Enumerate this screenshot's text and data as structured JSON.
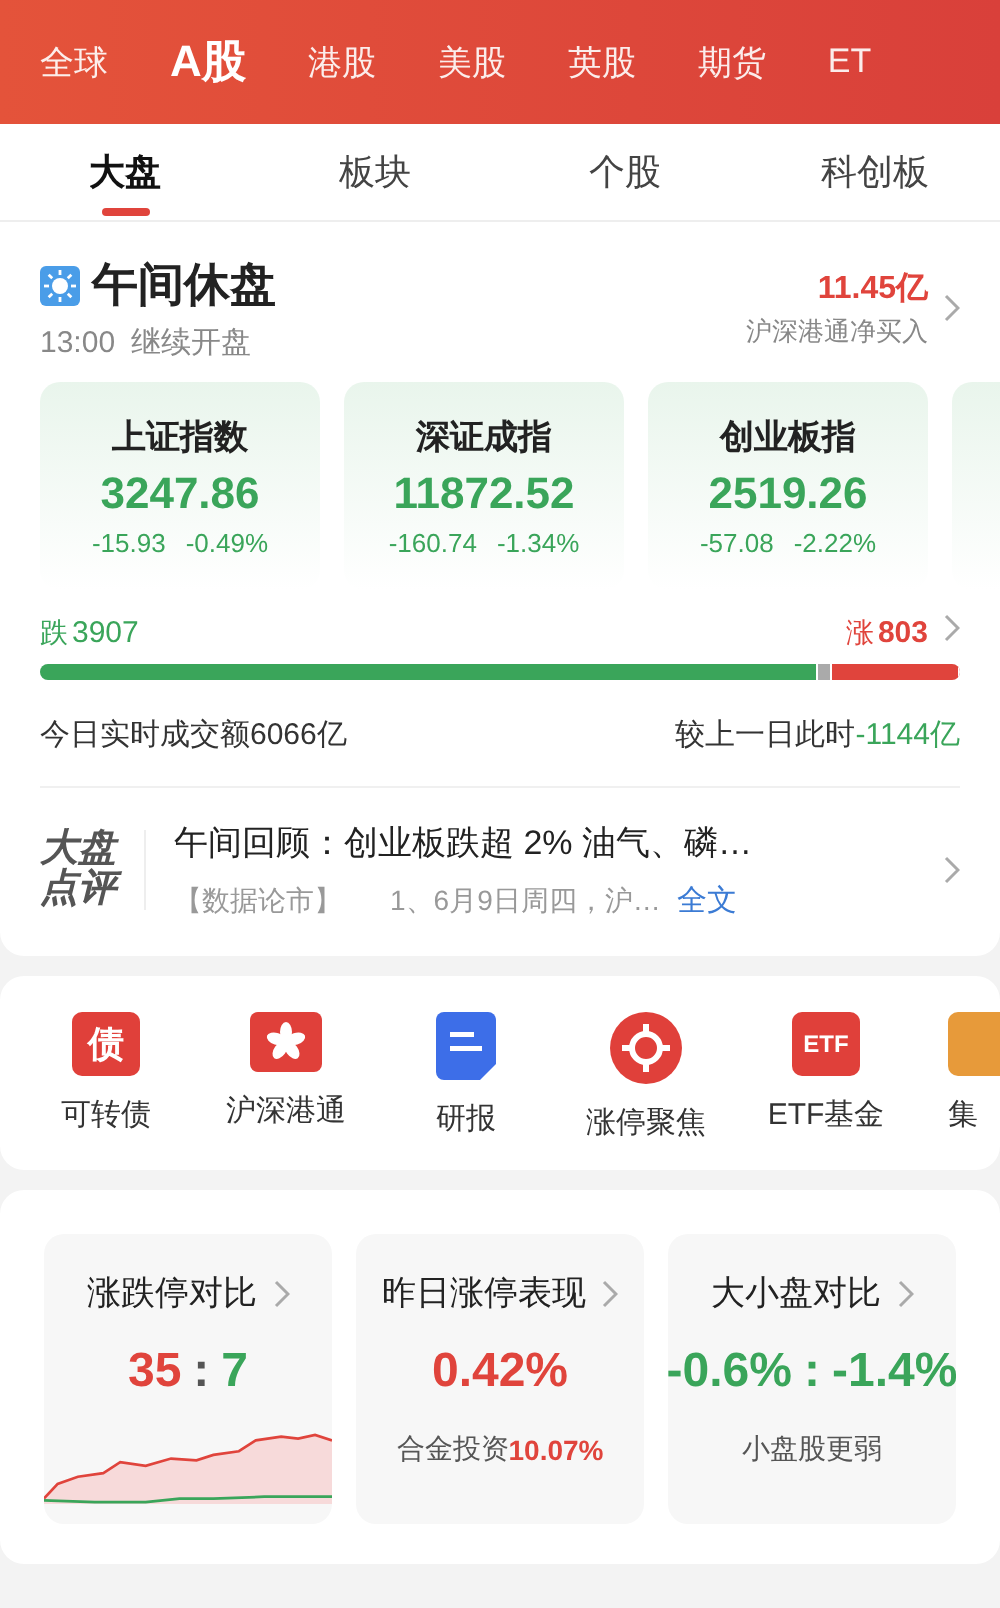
{
  "market_tabs": [
    {
      "label": "全球",
      "selected": false
    },
    {
      "label": "A股",
      "selected": true
    },
    {
      "label": "港股",
      "selected": false
    },
    {
      "label": "美股",
      "selected": false
    },
    {
      "label": "英股",
      "selected": false
    },
    {
      "label": "期货",
      "selected": false
    },
    {
      "label": "ET",
      "selected": false
    }
  ],
  "sub_tabs": [
    {
      "label": "大盘",
      "selected": true
    },
    {
      "label": "板块",
      "selected": false
    },
    {
      "label": "个股",
      "selected": false
    },
    {
      "label": "科创板",
      "selected": false
    }
  ],
  "session": {
    "title": "午间休盘",
    "time": "13:00",
    "note": "继续开盘",
    "flow_value": "11.45亿",
    "flow_label": "沪深港通净买入"
  },
  "indices": [
    {
      "kind": "index",
      "name": "上证指数",
      "price": "3247.86",
      "change": "-15.93",
      "percent": "-0.49%",
      "color": "#3aa55a"
    },
    {
      "kind": "index",
      "name": "深证成指",
      "price": "11872.52",
      "change": "-160.74",
      "percent": "-1.34%",
      "color": "#3aa55a"
    },
    {
      "kind": "index",
      "name": "创业板指",
      "price": "2519.26",
      "change": "-57.08",
      "percent": "-2.22%",
      "color": "#3aa55a"
    },
    {
      "kind": "cut"
    }
  ],
  "breadth": {
    "down_label": "跌",
    "down_count": "3907",
    "up_label": "涨",
    "up_count": "803",
    "segments": [
      {
        "kind": "down",
        "level": 0.845
      },
      {
        "kind": "flat"
      },
      {
        "kind": "up",
        "level": 0.14
      }
    ]
  },
  "turnover": {
    "label": "今日实时成交额",
    "value": "6066亿",
    "compare_label": "较上一日此时",
    "compare_value": "-1144亿"
  },
  "news": {
    "logo_top": "大盘",
    "logo_bottom": "点评",
    "title": "午间回顾：创业板跌超 2% 油气、磷…",
    "source": "【数据论市】",
    "snippet": "1、6月9日周四，沪…",
    "link": "全文"
  },
  "shortcuts": [
    {
      "kind": "glyph",
      "glyph": "债",
      "label": "可转债"
    },
    {
      "kind": "flower",
      "label": "沪深港通"
    },
    {
      "kind": "doc",
      "label": "研报"
    },
    {
      "kind": "target",
      "label": "涨停聚焦"
    },
    {
      "kind": "glyph",
      "glyph": "ETF",
      "label": "ETF基金"
    },
    {
      "kind": "cut",
      "label": "集"
    }
  ],
  "stat_cards": [
    {
      "title": "涨跌停对比",
      "value": [
        {
          "text": "35",
          "color": "#e0443c"
        },
        {
          "text": ":",
          "color": "#555555"
        },
        {
          "text": "7",
          "color": "#3aa55a"
        }
      ],
      "kind": "sparkline"
    },
    {
      "title": "昨日涨停表现",
      "value": [
        {
          "text": "0.42%",
          "color": "#e0443c"
        }
      ],
      "kind": "note",
      "note": [
        {
          "text": "合金投资",
          "color": "#555555"
        },
        {
          "text": "10.07%",
          "color": "#e0443c"
        }
      ]
    },
    {
      "title": "大小盘对比",
      "value": [
        {
          "text": "-0.6%",
          "color": "#3aa55a"
        },
        {
          "text": ":",
          "color": "#3aa55a"
        },
        {
          "text": "-1.4%",
          "color": "#3aa55a"
        }
      ],
      "kind": "note",
      "note": [
        {
          "text": "小盘股更弱",
          "color": "#555555"
        }
      ]
    }
  ]
}
